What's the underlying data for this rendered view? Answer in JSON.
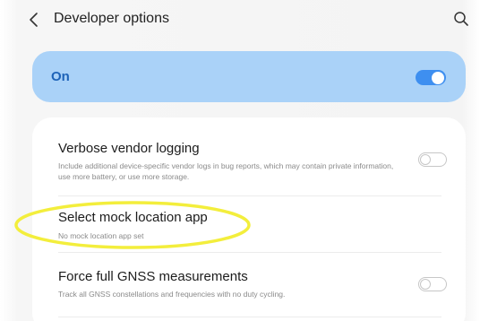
{
  "header": {
    "title": "Developer options",
    "back_icon": "chevron-left-icon",
    "search_icon": "search-icon"
  },
  "master_switch": {
    "label": "On",
    "state": "on",
    "background_color": "#aad2f8",
    "accent_color": "#3e8ff0"
  },
  "settings": {
    "items": [
      {
        "title": "Verbose vendor logging",
        "subtitle": "Include additional device-specific vendor logs in bug reports, which may contain private information, use more battery, or use more storage.",
        "toggle": "off"
      },
      {
        "title": "Select mock location app",
        "subtitle": "No mock location app set"
      },
      {
        "title": "Force full GNSS measurements",
        "subtitle": "Track all GNSS constellations and frequencies with no duty cycling.",
        "toggle": "off"
      }
    ]
  },
  "annotation": {
    "highlight_color": "#f3ee3c",
    "target": "Select mock location app"
  }
}
